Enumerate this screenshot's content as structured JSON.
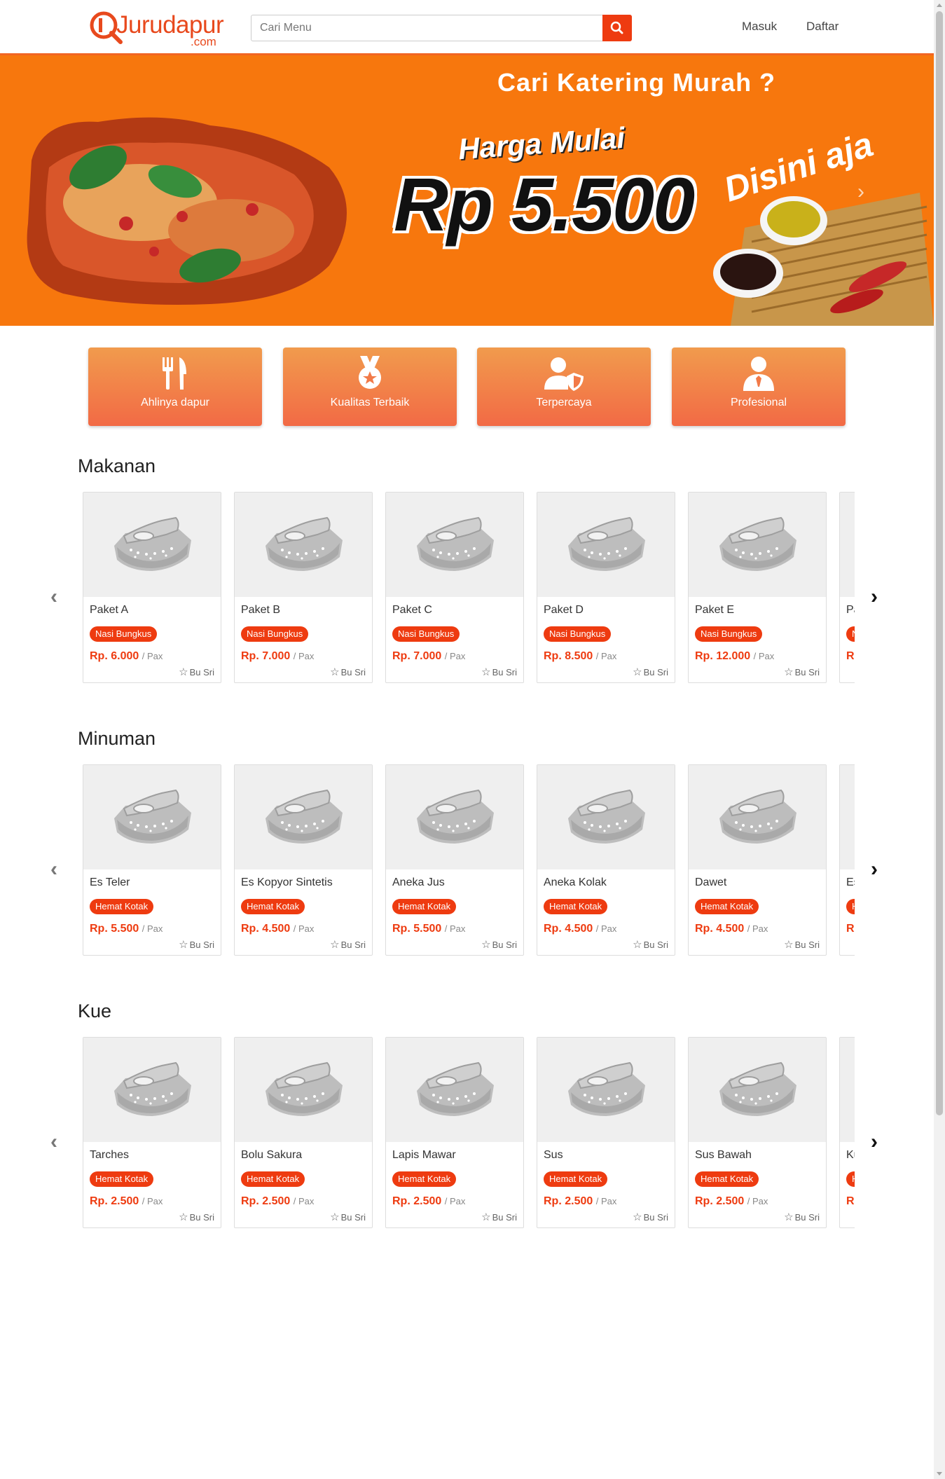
{
  "header": {
    "logo_main": "Jurudapur",
    "logo_sub": ".com",
    "search_placeholder": "Cari Menu",
    "login_label": "Masuk",
    "register_label": "Daftar"
  },
  "banner": {
    "headline": "Cari Katering Murah ?",
    "subline": "Harga Mulai",
    "price": "Rp 5.500",
    "tagline": "Disini aja",
    "next_icon": "chevron-right-icon"
  },
  "features": [
    {
      "label": "Ahlinya dapur",
      "icon": "utensils-icon"
    },
    {
      "label": "Kualitas Terbaik",
      "icon": "medal-icon"
    },
    {
      "label": "Terpercaya",
      "icon": "user-shield-icon"
    },
    {
      "label": "Profesional",
      "icon": "user-tie-icon"
    }
  ],
  "sections": [
    {
      "title": "Makanan",
      "items": [
        {
          "name": "Paket A",
          "badge": "Nasi Bungkus",
          "price": "Rp. 6.000",
          "unit": "/ Pax",
          "seller": "Bu Sri"
        },
        {
          "name": "Paket B",
          "badge": "Nasi Bungkus",
          "price": "Rp. 7.000",
          "unit": "/ Pax",
          "seller": "Bu Sri"
        },
        {
          "name": "Paket C",
          "badge": "Nasi Bungkus",
          "price": "Rp. 7.000",
          "unit": "/ Pax",
          "seller": "Bu Sri"
        },
        {
          "name": "Paket D",
          "badge": "Nasi Bungkus",
          "price": "Rp. 8.500",
          "unit": "/ Pax",
          "seller": "Bu Sri"
        },
        {
          "name": "Paket E",
          "badge": "Nasi Bungkus",
          "price": "Rp. 12.000",
          "unit": "/ Pax",
          "seller": "Bu Sri"
        },
        {
          "name": "Pa",
          "badge": "N",
          "price": "Rp",
          "unit": "",
          "seller": ""
        }
      ]
    },
    {
      "title": "Minuman",
      "items": [
        {
          "name": "Es Teler",
          "badge": "Hemat Kotak",
          "price": "Rp. 5.500",
          "unit": "/ Pax",
          "seller": "Bu Sri"
        },
        {
          "name": "Es Kopyor Sintetis",
          "badge": "Hemat Kotak",
          "price": "Rp. 4.500",
          "unit": "/ Pax",
          "seller": "Bu Sri"
        },
        {
          "name": "Aneka Jus",
          "badge": "Hemat Kotak",
          "price": "Rp. 5.500",
          "unit": "/ Pax",
          "seller": "Bu Sri"
        },
        {
          "name": "Aneka Kolak",
          "badge": "Hemat Kotak",
          "price": "Rp. 4.500",
          "unit": "/ Pax",
          "seller": "Bu Sri"
        },
        {
          "name": "Dawet",
          "badge": "Hemat Kotak",
          "price": "Rp. 4.500",
          "unit": "/ Pax",
          "seller": "Bu Sri"
        },
        {
          "name": "Es",
          "badge": "H",
          "price": "Rp",
          "unit": "",
          "seller": ""
        }
      ]
    },
    {
      "title": "Kue",
      "items": [
        {
          "name": "Tarches",
          "badge": "Hemat Kotak",
          "price": "Rp. 2.500",
          "unit": "/ Pax",
          "seller": "Bu Sri"
        },
        {
          "name": "Bolu Sakura",
          "badge": "Hemat Kotak",
          "price": "Rp. 2.500",
          "unit": "/ Pax",
          "seller": "Bu Sri"
        },
        {
          "name": "Lapis Mawar",
          "badge": "Hemat Kotak",
          "price": "Rp. 2.500",
          "unit": "/ Pax",
          "seller": "Bu Sri"
        },
        {
          "name": "Sus",
          "badge": "Hemat Kotak",
          "price": "Rp. 2.500",
          "unit": "/ Pax",
          "seller": "Bu Sri"
        },
        {
          "name": "Sus Bawah",
          "badge": "Hemat Kotak",
          "price": "Rp. 2.500",
          "unit": "/ Pax",
          "seller": "Bu Sri"
        },
        {
          "name": "Ku",
          "badge": "H",
          "price": "Rp",
          "unit": "",
          "seller": ""
        }
      ]
    }
  ],
  "colors": {
    "accent": "#ee3b10",
    "banner": "#f7770d",
    "feature_top": "#f19b4d",
    "feature_bottom": "#f26a45"
  }
}
